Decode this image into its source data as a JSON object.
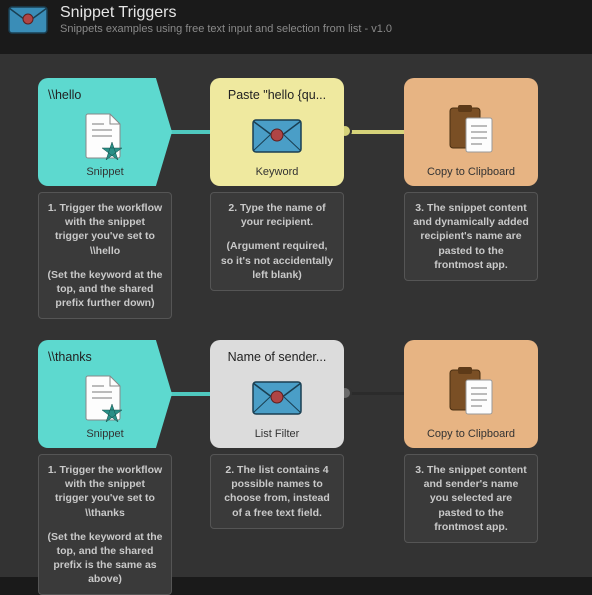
{
  "header": {
    "title": "Snippet Triggers",
    "subtitle": "Snippets examples using free text input and selection from list - v1.0"
  },
  "rows": [
    {
      "trigger": {
        "title": "\\\\hello",
        "sub": "Snippet",
        "desc": "1. Trigger the workflow with the snippet trigger you've set to \\\\hello",
        "desc2": "(Set the keyword at the top, and the shared prefix further down)"
      },
      "middle": {
        "type": "keyword",
        "title": "Paste \"hello {qu...",
        "sub": "Keyword",
        "desc": "2. Type the name of your recipient.",
        "desc2": "(Argument required, so it's not accidentally left blank)"
      },
      "action": {
        "title": "",
        "sub": "Copy to Clipboard",
        "desc": "3. The snippet content and dynamically added recipient's name are pasted to the frontmost app."
      }
    },
    {
      "trigger": {
        "title": "\\\\thanks",
        "sub": "Snippet",
        "desc": "1. Trigger the workflow with the snippet trigger you've set to \\\\thanks",
        "desc2": "(Set the keyword at the top, and the shared prefix is the same as above)"
      },
      "middle": {
        "type": "listfilter",
        "title": "Name of sender...",
        "sub": "List Filter",
        "desc": "2. The list contains 4 possible names to choose from, instead of a free text field."
      },
      "action": {
        "title": "",
        "sub": "Copy to Clipboard",
        "desc": "3. The snippet content and sender's name you selected are pasted to the frontmost app."
      }
    }
  ]
}
